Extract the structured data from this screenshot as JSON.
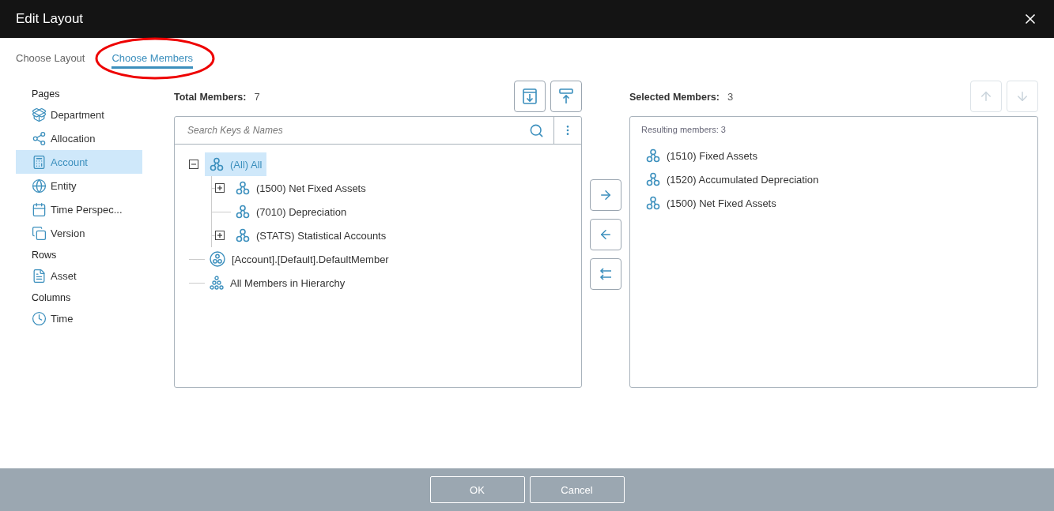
{
  "window": {
    "title": "Edit Layout"
  },
  "tabs": [
    {
      "label": "Choose Layout",
      "selected": false,
      "circled": false
    },
    {
      "label": "Choose Members",
      "selected": true,
      "circled": true
    }
  ],
  "sidebar": {
    "sections": [
      {
        "title": "Pages",
        "items": [
          {
            "label": "Department",
            "kind": "box",
            "selected": false
          },
          {
            "label": "Allocation",
            "kind": "share",
            "selected": false
          },
          {
            "label": "Account",
            "kind": "calculator",
            "selected": true
          },
          {
            "label": "Entity",
            "kind": "globe",
            "selected": false
          },
          {
            "label": "Time Perspec...",
            "kind": "calendar",
            "selected": false
          },
          {
            "label": "Version",
            "kind": "copy",
            "selected": false
          }
        ]
      },
      {
        "title": "Rows",
        "items": [
          {
            "label": "Asset",
            "kind": "list",
            "selected": false
          }
        ]
      },
      {
        "title": "Columns",
        "items": [
          {
            "label": "Time",
            "kind": "clock",
            "selected": false
          }
        ]
      }
    ]
  },
  "members": {
    "label": "Total Members:",
    "count": "7",
    "tools": [
      {
        "kind": "expand"
      },
      {
        "kind": "collapse"
      }
    ],
    "search": {
      "placeholder": "Search Keys & Names"
    },
    "tree": [
      {
        "label": "(All) All",
        "kind": "member",
        "selected": true,
        "expanded": true,
        "children": [
          {
            "label": "(1500) Net Fixed Assets",
            "kind": "member",
            "selected": false,
            "expanded": false
          },
          {
            "label": "(7010) Depreciation",
            "kind": "member",
            "selected": false
          },
          {
            "label": "(STATS) Statistical Accounts",
            "kind": "member",
            "selected": false,
            "expanded": false
          }
        ]
      },
      {
        "label": "[Account].[Default].DefaultMember",
        "kind": "default",
        "selected": false
      },
      {
        "label": "All Members in Hierarchy",
        "kind": "all",
        "selected": false
      }
    ]
  },
  "transfer_buttons": [
    {
      "kind": "add"
    },
    {
      "kind": "remove"
    },
    {
      "kind": "remove-all"
    }
  ],
  "selected_members": {
    "label": "Selected Members:",
    "count": "3",
    "reorder_buttons": [
      {
        "kind": "up",
        "disabled": true
      },
      {
        "kind": "down",
        "disabled": true
      }
    ],
    "summary": "Resulting members: 3",
    "items": [
      {
        "label": "(1510) Fixed Assets"
      },
      {
        "label": "(1520) Accumulated Depreciation"
      },
      {
        "label": "(1500) Net Fixed Assets"
      }
    ]
  },
  "buttons": [
    "OK",
    "Cancel"
  ]
}
